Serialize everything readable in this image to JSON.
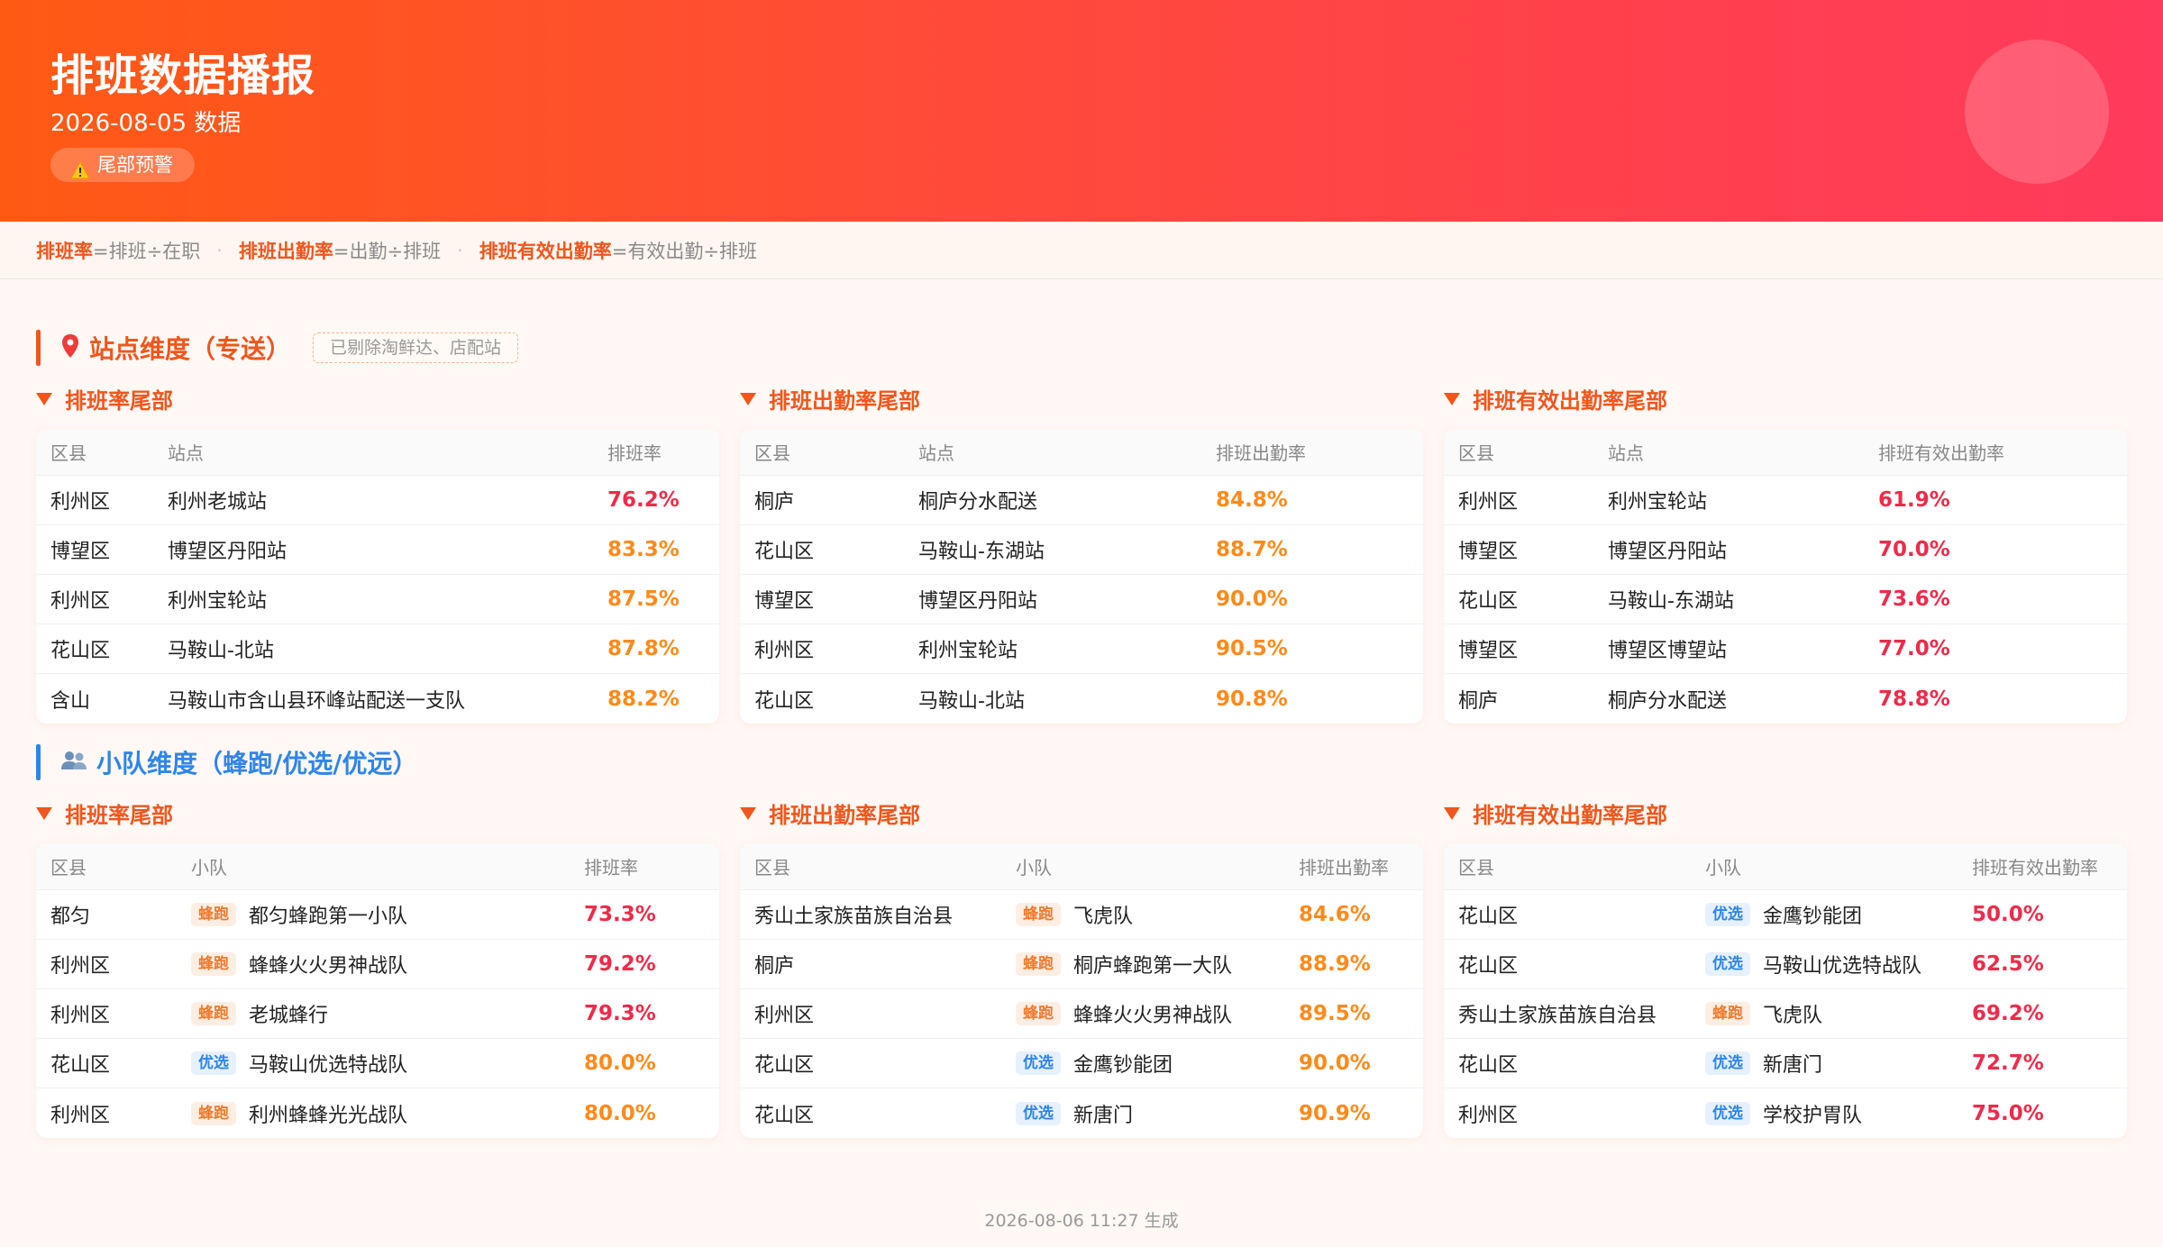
{
  "header": {
    "title": "排班数据播报",
    "date": "2026-08-05 数据",
    "badge": "尾部预警"
  },
  "formulas": [
    {
      "key": "排班率",
      "rest": "=排班÷在职"
    },
    {
      "key": "排班出勤率",
      "rest": "=出勤÷排班"
    },
    {
      "key": "排班有效出勤率",
      "rest": "=有效出勤÷排班"
    }
  ],
  "colors": {
    "accent": "#f0561c",
    "red_rate": "#ef2a4a",
    "orange_rate": "#ff8a1a",
    "blue_section": "#2f86e8"
  },
  "station_section": {
    "title": "站点维度（专送）",
    "tag": "已剔除淘鲜达、店配站",
    "icon": "pin-icon",
    "groups": [
      {
        "title": "排班率尾部",
        "headers": [
          "区县",
          "站点",
          "排班率"
        ],
        "rows": [
          {
            "district": "利州区",
            "name": "利州老城站",
            "rate": "76.2%",
            "level": "red"
          },
          {
            "district": "博望区",
            "name": "博望区丹阳站",
            "rate": "83.3%",
            "level": "orange"
          },
          {
            "district": "利州区",
            "name": "利州宝轮站",
            "rate": "87.5%",
            "level": "orange"
          },
          {
            "district": "花山区",
            "name": "马鞍山-北站",
            "rate": "87.8%",
            "level": "orange"
          },
          {
            "district": "含山",
            "name": "马鞍山市含山县环峰站配送一支队",
            "rate": "88.2%",
            "level": "orange"
          }
        ]
      },
      {
        "title": "排班出勤率尾部",
        "headers": [
          "区县",
          "站点",
          "排班出勤率"
        ],
        "rows": [
          {
            "district": "桐庐",
            "name": "桐庐分水配送",
            "rate": "84.8%",
            "level": "orange"
          },
          {
            "district": "花山区",
            "name": "马鞍山-东湖站",
            "rate": "88.7%",
            "level": "orange"
          },
          {
            "district": "博望区",
            "name": "博望区丹阳站",
            "rate": "90.0%",
            "level": "orange"
          },
          {
            "district": "利州区",
            "name": "利州宝轮站",
            "rate": "90.5%",
            "level": "orange"
          },
          {
            "district": "花山区",
            "name": "马鞍山-北站",
            "rate": "90.8%",
            "level": "orange"
          }
        ]
      },
      {
        "title": "排班有效出勤率尾部",
        "headers": [
          "区县",
          "站点",
          "排班有效出勤率"
        ],
        "rows": [
          {
            "district": "利州区",
            "name": "利州宝轮站",
            "rate": "61.9%",
            "level": "red"
          },
          {
            "district": "博望区",
            "name": "博望区丹阳站",
            "rate": "70.0%",
            "level": "red"
          },
          {
            "district": "花山区",
            "name": "马鞍山-东湖站",
            "rate": "73.6%",
            "level": "red"
          },
          {
            "district": "博望区",
            "name": "博望区博望站",
            "rate": "77.0%",
            "level": "red"
          },
          {
            "district": "桐庐",
            "name": "桐庐分水配送",
            "rate": "78.8%",
            "level": "red"
          }
        ]
      }
    ]
  },
  "team_section": {
    "title": "小队维度（蜂跑/优选/优远）",
    "icon": "people-icon",
    "groups": [
      {
        "title": "排班率尾部",
        "headers": [
          "区县",
          "小队",
          "排班率"
        ],
        "rows": [
          {
            "district": "都匀",
            "type": "蜂跑",
            "name": "都匀蜂跑第一小队",
            "rate": "73.3%",
            "level": "red"
          },
          {
            "district": "利州区",
            "type": "蜂跑",
            "name": "蜂蜂火火男神战队",
            "rate": "79.2%",
            "level": "red"
          },
          {
            "district": "利州区",
            "type": "蜂跑",
            "name": "老城蜂行",
            "rate": "79.3%",
            "level": "red"
          },
          {
            "district": "花山区",
            "type": "优选",
            "name": "马鞍山优选特战队",
            "rate": "80.0%",
            "level": "orange"
          },
          {
            "district": "利州区",
            "type": "蜂跑",
            "name": "利州蜂蜂光光战队",
            "rate": "80.0%",
            "level": "orange"
          }
        ]
      },
      {
        "title": "排班出勤率尾部",
        "headers": [
          "区县",
          "小队",
          "排班出勤率"
        ],
        "rows": [
          {
            "district": "秀山土家族苗族自治县",
            "type": "蜂跑",
            "name": "飞虎队",
            "rate": "84.6%",
            "level": "orange"
          },
          {
            "district": "桐庐",
            "type": "蜂跑",
            "name": "桐庐蜂跑第一大队",
            "rate": "88.9%",
            "level": "orange"
          },
          {
            "district": "利州区",
            "type": "蜂跑",
            "name": "蜂蜂火火男神战队",
            "rate": "89.5%",
            "level": "orange"
          },
          {
            "district": "花山区",
            "type": "优选",
            "name": "金鹰钞能团",
            "rate": "90.0%",
            "level": "orange"
          },
          {
            "district": "花山区",
            "type": "优选",
            "name": "新唐门",
            "rate": "90.9%",
            "level": "orange"
          }
        ]
      },
      {
        "title": "排班有效出勤率尾部",
        "headers": [
          "区县",
          "小队",
          "排班有效出勤率"
        ],
        "rows": [
          {
            "district": "花山区",
            "type": "优选",
            "name": "金鹰钞能团",
            "rate": "50.0%",
            "level": "red"
          },
          {
            "district": "花山区",
            "type": "优选",
            "name": "马鞍山优选特战队",
            "rate": "62.5%",
            "level": "red"
          },
          {
            "district": "秀山土家族苗族自治县",
            "type": "蜂跑",
            "name": "飞虎队",
            "rate": "69.2%",
            "level": "red"
          },
          {
            "district": "花山区",
            "type": "优选",
            "name": "新唐门",
            "rate": "72.7%",
            "level": "red"
          },
          {
            "district": "利州区",
            "type": "优选",
            "name": "学校护胃队",
            "rate": "75.0%",
            "level": "red"
          }
        ]
      }
    ]
  },
  "footer": "2026-08-06 11:27 生成"
}
